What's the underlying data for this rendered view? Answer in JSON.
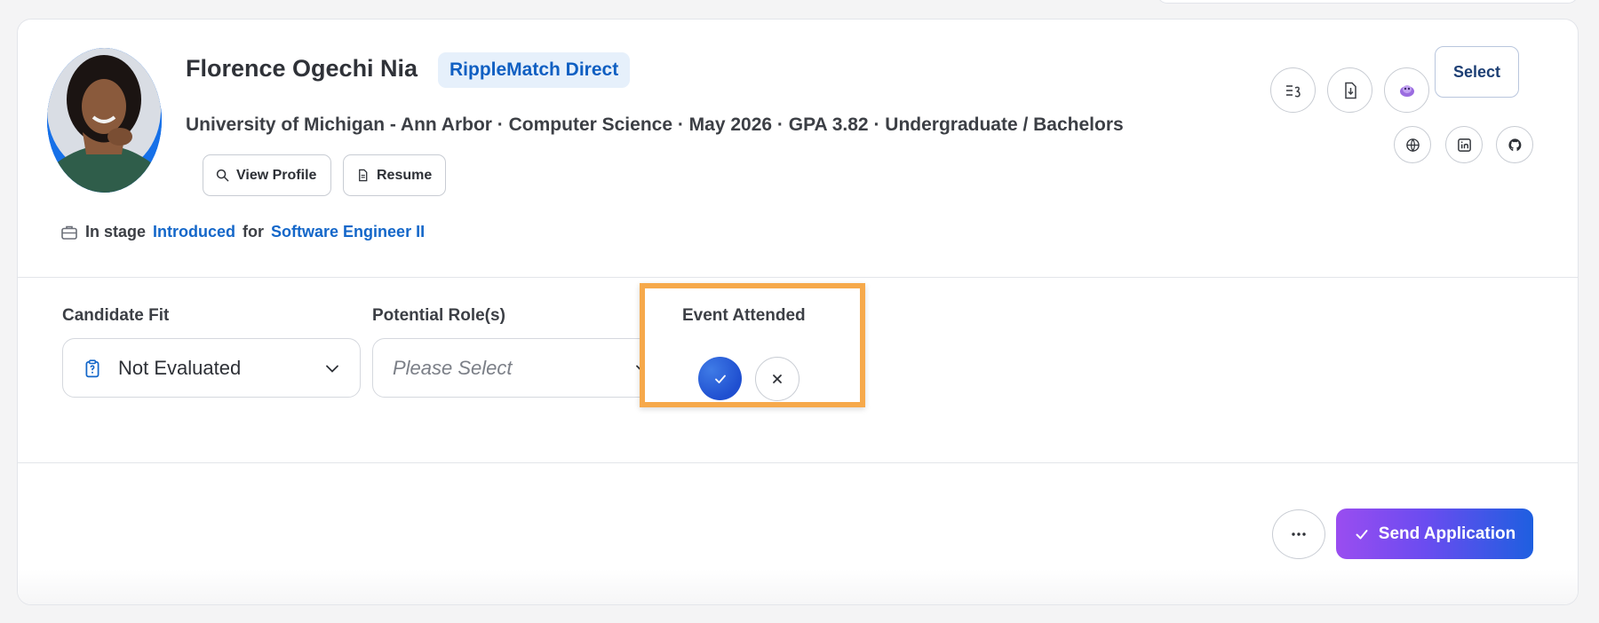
{
  "candidate": {
    "name": "Florence Ogechi Nia",
    "source_badge": "RippleMatch Direct",
    "meta": "University of Michigan - Ann Arbor · Computer Science · May 2026 · GPA 3.82 · Undergraduate / Bachelors"
  },
  "actions": {
    "view_profile": "View Profile",
    "resume": "Resume",
    "select": "Select"
  },
  "stage": {
    "prefix": "In stage",
    "stage_name": "Introduced",
    "connector": "for",
    "role": "Software Engineer II"
  },
  "fields": {
    "candidate_fit": {
      "label": "Candidate Fit",
      "value": "Not Evaluated"
    },
    "potential_roles": {
      "label": "Potential Role(s)",
      "placeholder": "Please Select"
    },
    "event_attended": {
      "label": "Event Attended"
    }
  },
  "footer": {
    "send_application": "Send Application",
    "more": "···"
  },
  "colors": {
    "brand_blue": "#1467c9",
    "highlight": "#f6a94b",
    "send_gradient_start": "#9a4df0",
    "send_gradient_end": "#1e5fe0"
  },
  "icons": [
    "list-score-icon",
    "download-doc-icon",
    "ai-assistant-icon",
    "globe-icon",
    "linkedin-icon",
    "github-icon",
    "search-icon",
    "document-icon",
    "briefcase-icon",
    "clipboard-icon",
    "chevron-down-icon",
    "check-icon",
    "close-icon",
    "more-icon"
  ]
}
